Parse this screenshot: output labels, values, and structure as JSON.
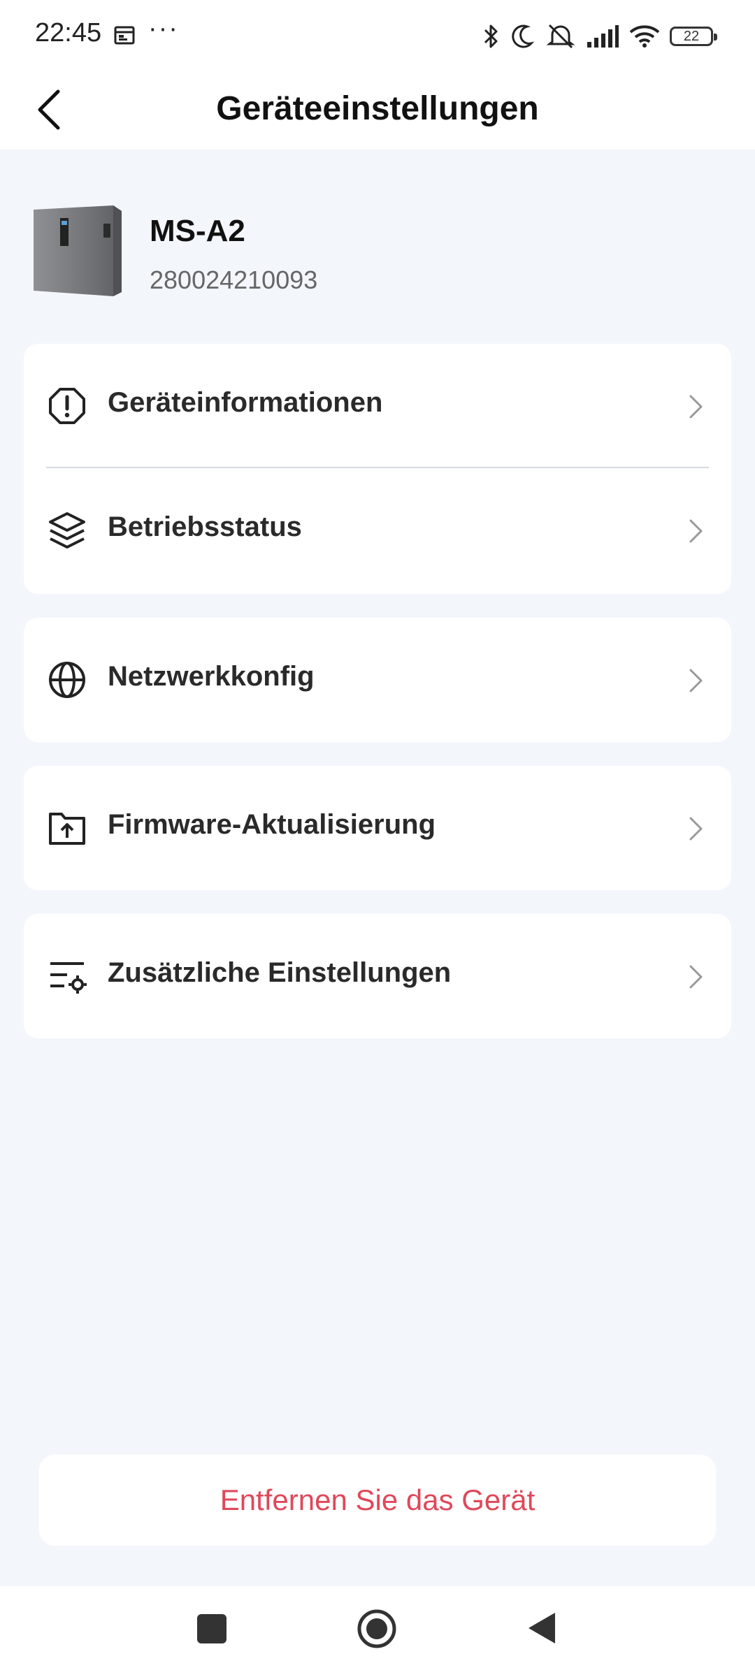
{
  "status_bar": {
    "time": "22:45",
    "more": "···",
    "battery": "22",
    "icons": [
      "calendar-icon",
      "bluetooth-icon",
      "moon-icon",
      "mute-icon",
      "signal-icon",
      "wifi-icon",
      "battery-icon"
    ]
  },
  "header": {
    "title": "Geräteeinstellungen",
    "back_icon": "chevron-left-icon"
  },
  "device": {
    "name": "MS-A2",
    "serial": "280024210093"
  },
  "menu": {
    "group1": [
      {
        "label": "Geräteinformationen",
        "icon": "info-octagon-icon"
      },
      {
        "label": "Betriebsstatus",
        "icon": "layers-icon"
      }
    ],
    "network": {
      "label": "Netzwerkkonfig",
      "icon": "globe-icon"
    },
    "firmware": {
      "label": "Firmware-Aktualisierung",
      "icon": "folder-upload-icon"
    },
    "extra": {
      "label": "Zusätzliche Einstellungen",
      "icon": "settings-list-icon"
    }
  },
  "remove_button": {
    "label": "Entfernen Sie das Gerät",
    "color": "#e0485a"
  },
  "colors": {
    "background": "#f3f6fb",
    "card": "#ffffff",
    "text": "#2a2a2a"
  }
}
